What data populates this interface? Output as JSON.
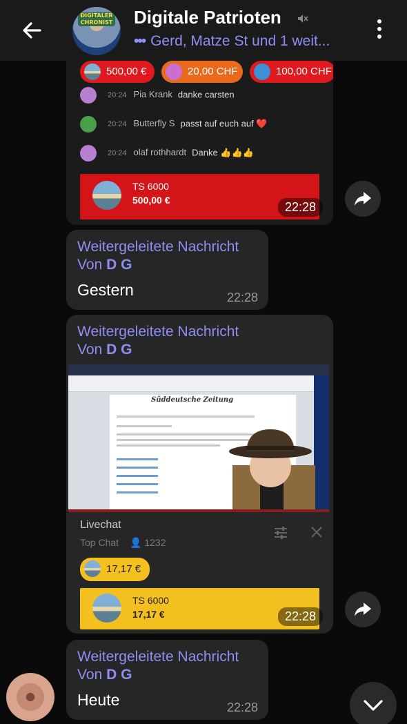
{
  "header": {
    "title": "Digitale Patrioten",
    "avatar_label": "DIGITALER CHRONIST",
    "subtitle_typing": "•••",
    "subtitle": "Gerd, Matze St und 1 weit..."
  },
  "media1": {
    "chips": [
      {
        "amount": "500,00 €",
        "color": "#e0191f"
      },
      {
        "amount": "20,00 CHF",
        "color": "#e96a1d"
      },
      {
        "amount": "100,00 CHF",
        "color": "#e0191f"
      }
    ],
    "chat": [
      {
        "time": "20:24",
        "name": "Pia Krank",
        "text": "danke carsten",
        "avatar_color": "#b87fcf"
      },
      {
        "time": "20:24",
        "name": "Butterfly S",
        "text": "passt auf euch auf ❤️",
        "avatar_color": "#4a9e4a"
      },
      {
        "time": "20:24",
        "name": "olaf rothhardt",
        "text": "Danke 👍👍👍",
        "avatar_color": "#b87fcf"
      }
    ],
    "donation": {
      "name": "TS 6000",
      "amount": "500,00 €",
      "color": "#d31418"
    },
    "time": "22:28"
  },
  "msg1": {
    "forwarded": "Weitergeleitete Nachricht",
    "from_prefix": "Von",
    "from_name": "D G",
    "text": "Gestern",
    "time": "22:28"
  },
  "msg2": {
    "forwarded": "Weitergeleitete Nachricht",
    "from_prefix": "Von",
    "from_name": "D G",
    "video_newspaper": "Süddeutsche Zeitung",
    "livechat_title": "Livechat",
    "livechat_sub": "Top Chat",
    "livechat_count": "1232",
    "chip_amount": "17,17 €",
    "chip_color": "#f4c020",
    "donation": {
      "name": "TS 6000",
      "amount": "17,17 €",
      "color": "#f4c020"
    },
    "time": "22:28"
  },
  "msg3": {
    "forwarded": "Weitergeleitete Nachricht",
    "from_prefix": "Von",
    "from_name": "D G",
    "text": "Heute",
    "time": "22:28"
  },
  "colors": {
    "accent": "#8e8ff3",
    "bubble": "#262626",
    "background": "#0a0a0a"
  }
}
